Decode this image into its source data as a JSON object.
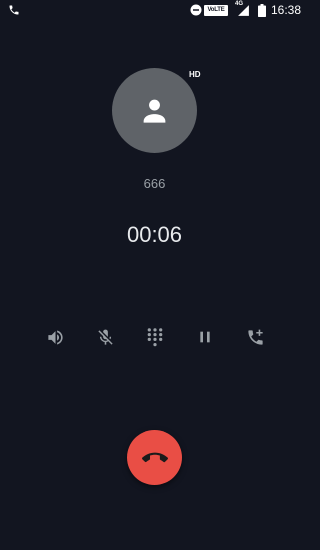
{
  "status_bar": {
    "call_icon": "phone-icon",
    "dnd_icon": "do-not-disturb-icon",
    "volte_label": "VoLTE",
    "network_type": "4G",
    "signal_icon": "signal-icon",
    "battery_icon": "battery-icon",
    "time": "16:38"
  },
  "call": {
    "hd_label": "HD",
    "caller_number": "666",
    "timer": "00:06"
  },
  "controls": [
    {
      "name": "speaker",
      "icon": "speaker-icon"
    },
    {
      "name": "mute",
      "icon": "mic-off-icon"
    },
    {
      "name": "keypad",
      "icon": "dialpad-icon"
    },
    {
      "name": "hold",
      "icon": "pause-icon"
    },
    {
      "name": "add-call",
      "icon": "add-call-icon"
    }
  ],
  "colors": {
    "background": "#121520",
    "avatar": "#5f6368",
    "end_call": "#e94e45",
    "icon": "#9aa0a6"
  }
}
